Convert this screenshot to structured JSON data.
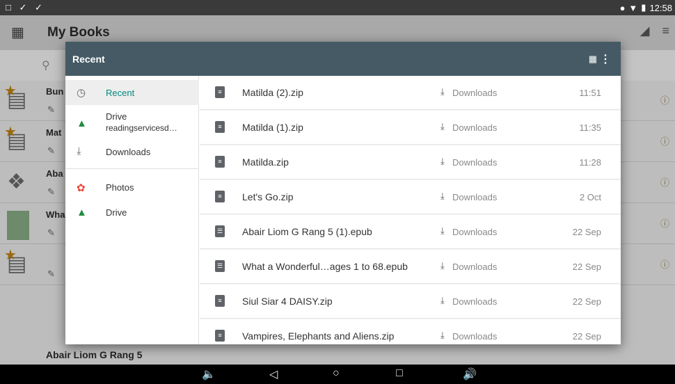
{
  "status": {
    "time": "12:58",
    "left_icons": "□ ✓ ✓"
  },
  "app": {
    "title": "My Books",
    "books": [
      {
        "title": "Bun"
      },
      {
        "title": "Mat"
      },
      {
        "title": "Aba"
      },
      {
        "title": "Wha"
      },
      {
        "title": ""
      }
    ],
    "last_book": "Abair Liom G Rang 5"
  },
  "picker": {
    "title": "Recent",
    "roots": [
      {
        "label": "Recent",
        "icon": "clock-icon"
      },
      {
        "label": "Drive",
        "sub": "readingservicesd…",
        "icon": "drive-icon"
      },
      {
        "label": "Downloads",
        "icon": "download-icon"
      },
      {
        "label": "Photos",
        "icon": "photos-icon"
      },
      {
        "label": "Drive",
        "icon": "drive-icon"
      }
    ],
    "files": [
      {
        "name": "Matilda (2).zip",
        "location": "Downloads",
        "date": "11:51",
        "type": "zip"
      },
      {
        "name": "Matilda (1).zip",
        "location": "Downloads",
        "date": "11:35",
        "type": "zip"
      },
      {
        "name": "Matilda.zip",
        "location": "Downloads",
        "date": "11:28",
        "type": "zip"
      },
      {
        "name": "Let's Go.zip",
        "location": "Downloads",
        "date": "2 Oct",
        "type": "zip"
      },
      {
        "name": "Abair Liom G Rang 5 (1).epub",
        "location": "Downloads",
        "date": "22 Sep",
        "type": "epub"
      },
      {
        "name": "What a Wonderful…ages 1 to 68.epub",
        "location": "Downloads",
        "date": "22 Sep",
        "type": "epub"
      },
      {
        "name": "Siul Siar 4 DAISY.zip",
        "location": "Downloads",
        "date": "22 Sep",
        "type": "zip"
      },
      {
        "name": "Vampires, Elephants and Aliens.zip",
        "location": "Downloads",
        "date": "22 Sep",
        "type": "zip"
      }
    ]
  },
  "colors": {
    "header": "#455a64",
    "accent": "#00897b"
  }
}
